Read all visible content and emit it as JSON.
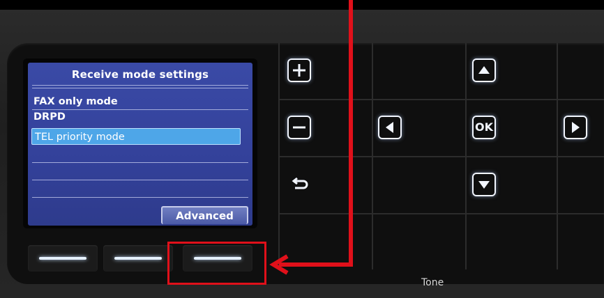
{
  "lcd": {
    "title": "Receive mode settings",
    "items": [
      {
        "label": "FAX only mode"
      },
      {
        "label": "DRPD"
      },
      {
        "label": "TEL priority mode",
        "selected": true
      }
    ],
    "advanced_label": "Advanced"
  },
  "keypad": {
    "ok_label": "OK",
    "tone_label": "Tone"
  },
  "colors": {
    "lcd_background": "#3a4aa6",
    "selection": "#4ea6e8",
    "annotation_red": "#e0101a",
    "key_glow": "#f2f6ff"
  },
  "icons": {
    "plus": "plus-icon",
    "minus": "minus-icon",
    "back": "back-arrow-icon",
    "up": "up-arrow-icon",
    "down": "down-arrow-icon",
    "left": "left-arrow-icon",
    "right": "right-arrow-icon"
  }
}
